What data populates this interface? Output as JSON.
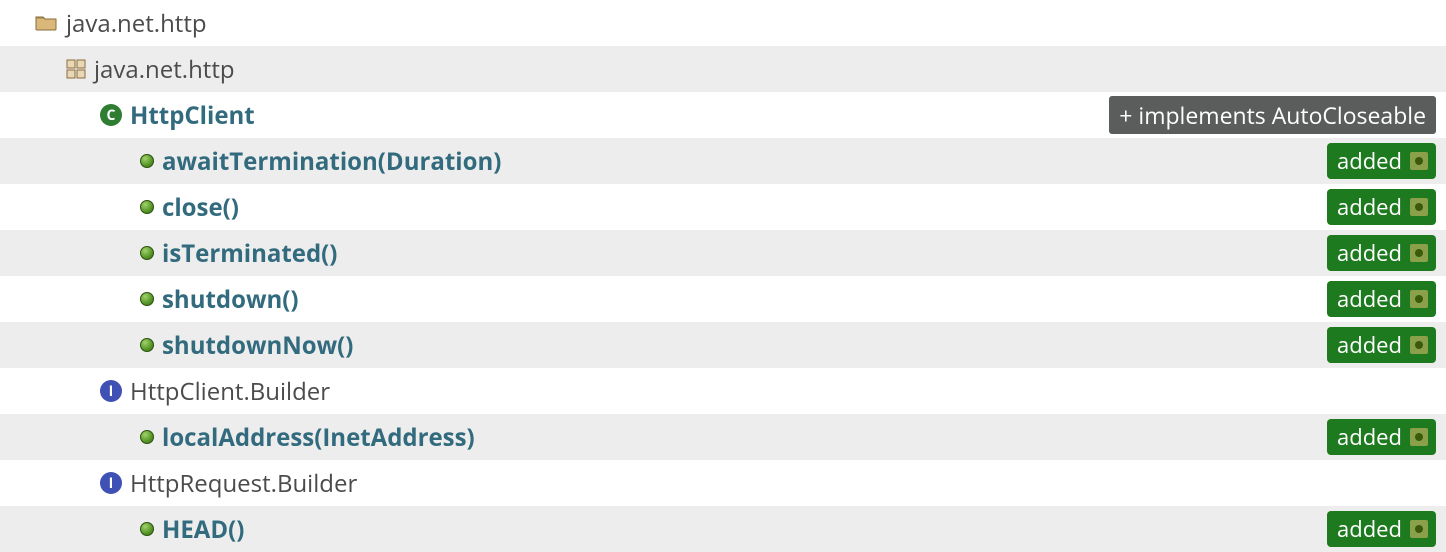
{
  "module": {
    "name": "java.net.http"
  },
  "package": {
    "name": "java.net.http"
  },
  "badges": {
    "added": "added",
    "implements": "+ implements AutoCloseable",
    "classLetter": "C",
    "interfaceLetter": "I"
  },
  "entries": [
    {
      "kind": "class",
      "name": "HttpClient",
      "link": true,
      "rightBadge": "implements",
      "shaded": false,
      "children": [
        {
          "kind": "method",
          "name": "awaitTermination(Duration)",
          "link": true,
          "rightBadge": "added",
          "shaded": true
        },
        {
          "kind": "method",
          "name": "close()",
          "link": true,
          "rightBadge": "added",
          "shaded": false
        },
        {
          "kind": "method",
          "name": "isTerminated()",
          "link": true,
          "rightBadge": "added",
          "shaded": true
        },
        {
          "kind": "method",
          "name": "shutdown()",
          "link": true,
          "rightBadge": "added",
          "shaded": false
        },
        {
          "kind": "method",
          "name": "shutdownNow()",
          "link": true,
          "rightBadge": "added",
          "shaded": true
        }
      ]
    },
    {
      "kind": "interface",
      "name": "HttpClient.Builder",
      "link": false,
      "rightBadge": null,
      "shaded": false,
      "children": [
        {
          "kind": "method",
          "name": "localAddress(InetAddress)",
          "link": true,
          "rightBadge": "added",
          "shaded": true
        }
      ]
    },
    {
      "kind": "interface",
      "name": "HttpRequest.Builder",
      "link": false,
      "rightBadge": null,
      "shaded": false,
      "children": [
        {
          "kind": "method",
          "name": "HEAD()",
          "link": true,
          "rightBadge": "added",
          "shaded": true
        }
      ]
    }
  ]
}
